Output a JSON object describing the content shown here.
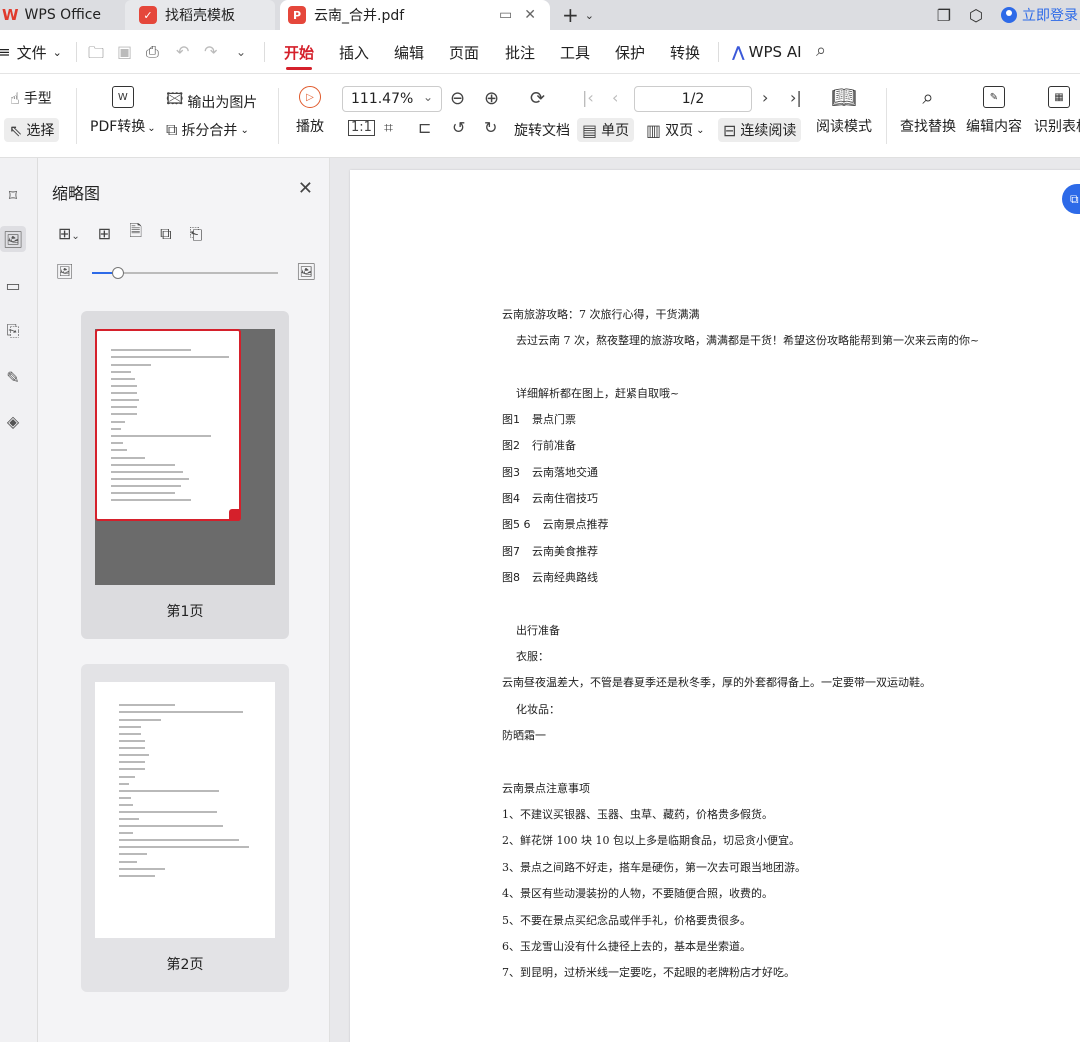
{
  "tabs": {
    "app_label": "WPS Office",
    "template_label": "找稻壳模板",
    "doc_label": "云南_合并.pdf",
    "login_label": "立即登录"
  },
  "menu": {
    "file_label": "文件",
    "items": [
      "开始",
      "插入",
      "编辑",
      "页面",
      "批注",
      "工具",
      "保护",
      "转换"
    ],
    "wps_ai_label": "WPS AI"
  },
  "ribbon": {
    "hand_label": "手型",
    "select_label": "选择",
    "pdf_convert_label": "PDF转换",
    "export_image_label": "输出为图片",
    "split_merge_label": "拆分合并",
    "play_label": "播放",
    "zoom_value": "111.47%",
    "page_value": "1/2",
    "rotate_label": "旋转文档",
    "single_page_label": "单页",
    "double_page_label": "双页",
    "continuous_label": "连续阅读",
    "read_mode_label": "阅读模式",
    "find_replace_label": "查找替换",
    "edit_content_label": "编辑内容",
    "recognize_table_label": "识别表格"
  },
  "thumbnails": {
    "title": "缩略图",
    "pages": [
      {
        "label": "第1页",
        "selected": true
      },
      {
        "label": "第2页",
        "selected": false
      }
    ]
  },
  "document": {
    "title": "云南旅游攻略：7 次旅行心得，干货满满",
    "intro": "去过云南 7 次，熬夜整理的旅游攻略，满满都是干货！希望这份攻略能帮到第一次来云南的你~",
    "detail_note": "详细解析都在图上，赶紧自取哦~",
    "figures": [
      {
        "fig": "图1",
        "text": "景点门票"
      },
      {
        "fig": "图2",
        "text": "行前准备"
      },
      {
        "fig": "图3",
        "text": "云南落地交通"
      },
      {
        "fig": "图4",
        "text": "云南住宿技巧"
      },
      {
        "fig": "图5 6",
        "text": "云南景点推荐"
      },
      {
        "fig": "图7",
        "text": "云南美食推荐"
      },
      {
        "fig": "图8",
        "text": "云南经典路线"
      }
    ],
    "prep_heading": "出行准备",
    "clothes_label": "衣服：",
    "clothes_text": "云南昼夜温差大，不管是春夏季还是秋冬季，厚的外套都得备上。一定要带一双运动鞋。",
    "cosmetics_label": "化妆品：",
    "cosmetics_text": "防晒霜一",
    "notes_heading": "云南景点注意事项",
    "notes": [
      "1、不建议买银器、玉器、虫草、藏药，价格贵多假货。",
      "2、鲜花饼 100 块 10 包以上多是临期食品，切忌贪小便宜。",
      "3、景点之间路不好走，搭车是硬伤，第一次去可跟当地团游。",
      "4、景区有些动漫装扮的人物，不要随便合照，收费的。",
      "5、不要在景点买纪念品或伴手礼，价格要贵很多。",
      "6、玉龙雪山没有什么捷径上去的，基本是坐索道。",
      "7、到昆明，过桥米线一定要吃，不起眼的老牌粉店才好吃。"
    ]
  }
}
